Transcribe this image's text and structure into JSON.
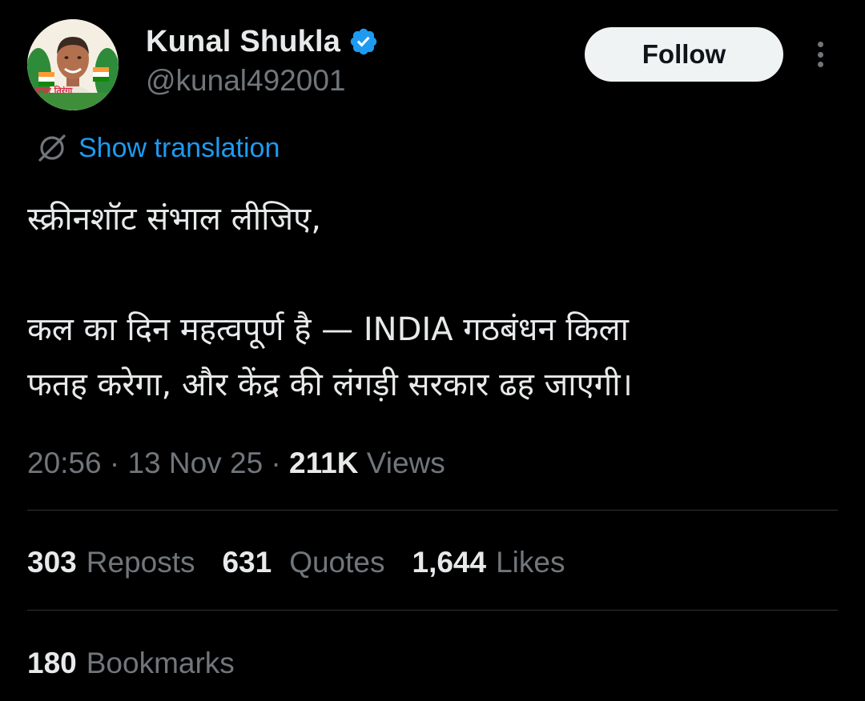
{
  "author": {
    "display_name": "Kunal Shukla",
    "handle": "@kunal492001",
    "verified": true,
    "avatar_badge_text": "हमार तिरंगा"
  },
  "actions": {
    "follow_label": "Follow",
    "more_icon": "more-vertical-icon"
  },
  "translation": {
    "label": "Show translation",
    "icon": "translate-icon"
  },
  "tweet": {
    "paragraph_1": "स्क्रीनशॉट संभाल लीजिए,",
    "paragraph_2_line_1": "कल का दिन महत्वपूर्ण है — INDIA गठबंधन किला",
    "paragraph_2_line_2": "फतह करेगा, और केंद्र की लंगड़ी सरकार ढह जाएगी।"
  },
  "meta": {
    "time": "20:56",
    "separator": " · ",
    "date": "13 Nov 25",
    "views_count": "211K",
    "views_label": "Views"
  },
  "stats": {
    "reposts_count": "303",
    "reposts_label": "Reposts",
    "quotes_count": "631",
    "quotes_label": "Quotes",
    "likes_count": "1,644",
    "likes_label": "Likes",
    "bookmarks_count": "180",
    "bookmarks_label": "Bookmarks"
  },
  "colors": {
    "background": "#000000",
    "text_primary": "#e7e9ea",
    "text_secondary": "#71767b",
    "accent_blue": "#1d9bf0",
    "divider": "#2f3336",
    "follow_bg": "#eff3f4"
  }
}
